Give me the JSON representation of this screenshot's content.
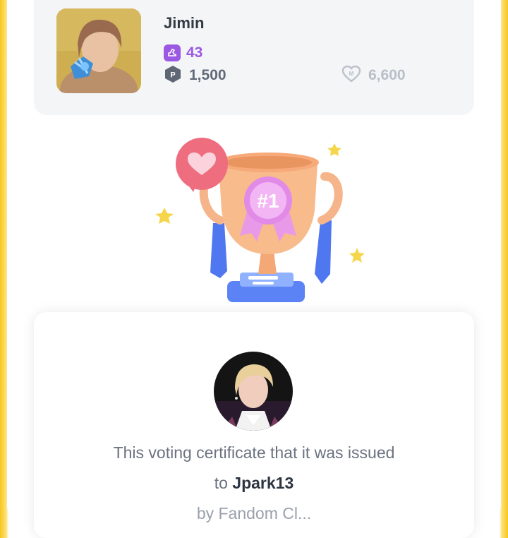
{
  "profile": {
    "name": "Jimin",
    "votes": "43",
    "points": "1,500",
    "hearts": "6,600"
  },
  "icons": {
    "vote": "vote-ticket-icon",
    "points": "point-badge-icon",
    "hearts": "heart-icon",
    "trophy": "trophy-icon"
  },
  "trophy": {
    "rank_label": "#1"
  },
  "certificate": {
    "text": "This voting certificate that it was issued",
    "to_label": "to",
    "username": "Jpark13",
    "line3": "by Fandom Cl..."
  },
  "colors": {
    "accent_purple": "#9b59e3",
    "frame_yellow": "#f7c61d",
    "card_gray": "#f4f5f7"
  }
}
